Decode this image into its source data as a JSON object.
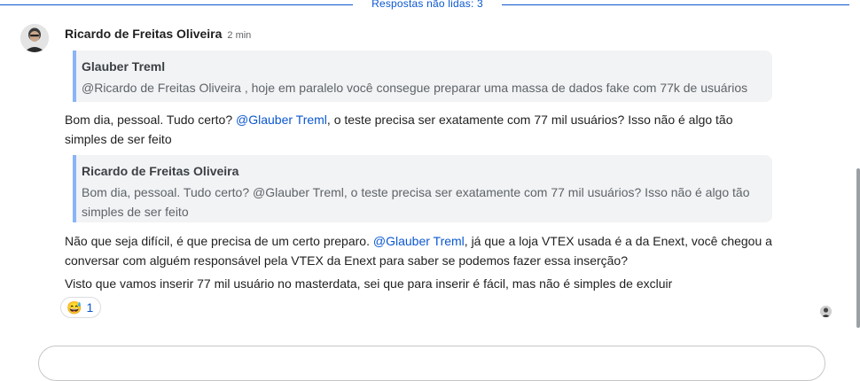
{
  "unread_divider": {
    "label": "Respostas não lidas: 3"
  },
  "message": {
    "author": "Ricardo de Freitas Oliveira",
    "time": "2 min",
    "quote1": {
      "author": "Glauber Treml",
      "text": "@Ricardo de Freitas Oliveira , hoje em paralelo você consegue preparar uma massa de dados fake com 77k de usuários"
    },
    "para1": {
      "pre": "Bom dia, pessoal. Tudo certo? ",
      "mention": "@Glauber Treml",
      "post": ", o teste precisa ser exatamente com 77 mil usuários? Isso não é algo tão simples de ser feito"
    },
    "quote2": {
      "author": "Ricardo de Freitas Oliveira",
      "text": "Bom dia, pessoal. Tudo certo? @Glauber Treml, o teste precisa ser exatamente com 77 mil usuários? Isso não é algo tão simples de ser feito"
    },
    "para2": {
      "pre": "Não que seja difícil, é que precisa de um certo preparo. ",
      "mention": "@Glauber Treml",
      "post": ", já que a loja VTEX usada é a da Enext, você chegou a conversar com alguém responsável pela VTEX da Enext para saber se podemos fazer essa inserção?"
    },
    "para3": "Visto que vamos inserir 77 mil usuário no masterdata, sei que para inserir é fácil, mas não é simples de excluir",
    "reaction": {
      "emoji": "😅",
      "count": "1"
    }
  },
  "colors": {
    "accent": "#0b57d0",
    "quote_bar": "#8ab4f8",
    "quote_bg": "#f1f3f4"
  },
  "icons": {
    "avatar": "user-avatar",
    "read_receipt": "read-receipt-avatar"
  }
}
